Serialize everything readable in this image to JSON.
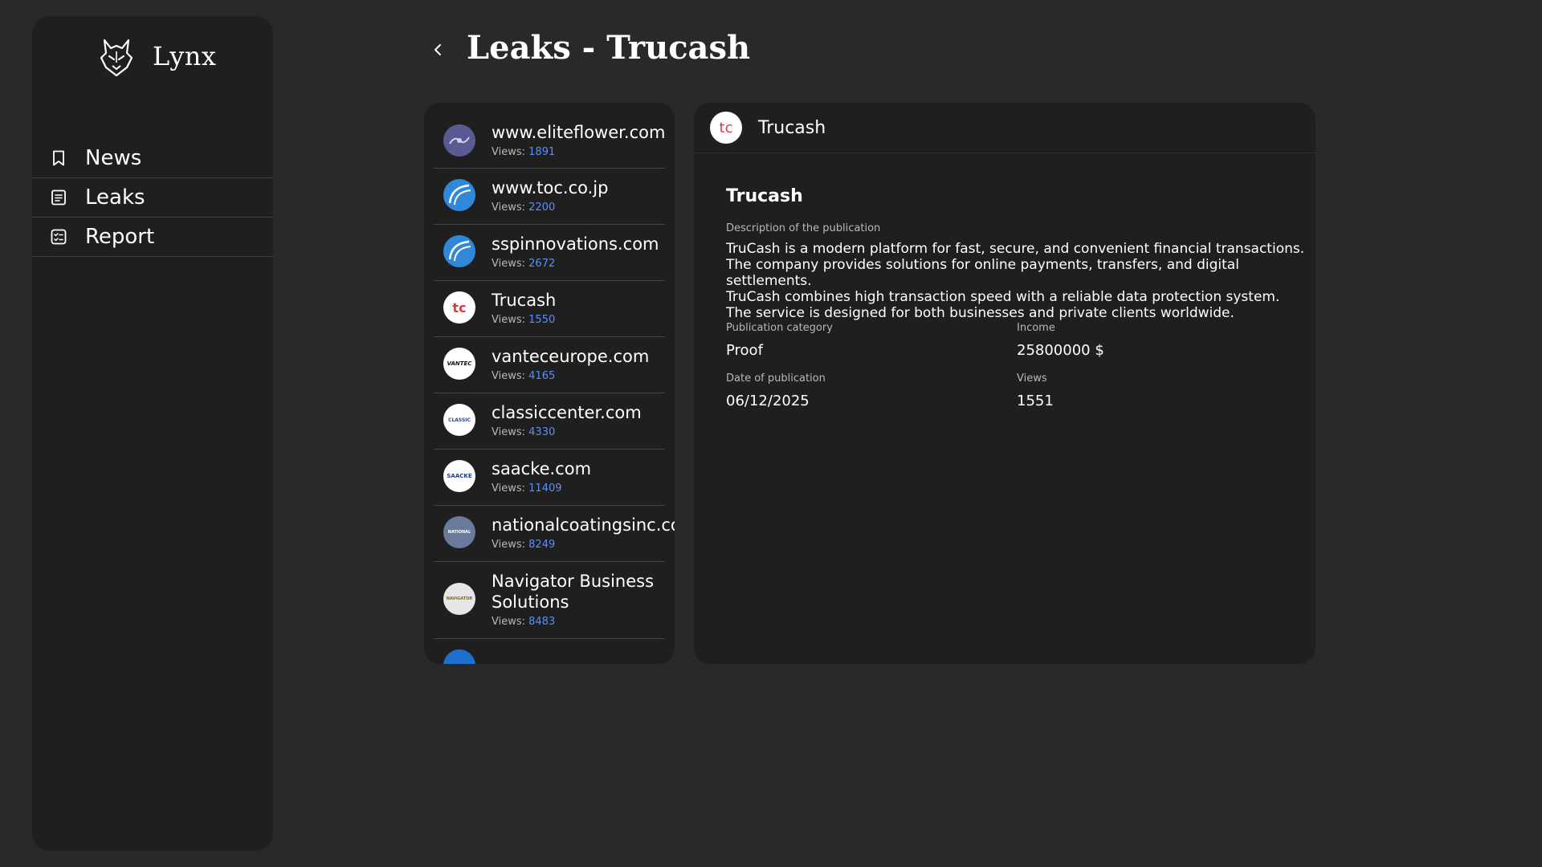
{
  "app": {
    "name": "Lynx"
  },
  "nav": [
    {
      "label": "News",
      "icon": "bookmark-icon"
    },
    {
      "label": "Leaks",
      "icon": "list-icon"
    },
    {
      "label": "Report",
      "icon": "checklist-icon"
    }
  ],
  "page": {
    "title": "Leaks - Trucash"
  },
  "views_label": "Views:",
  "leaks": [
    {
      "name": "www.eliteflower.com",
      "views": "1891",
      "avatar_color": "#5a5a92"
    },
    {
      "name": "www.toc.co.jp",
      "views": "2200",
      "avatar_color": "#2f88d8"
    },
    {
      "name": "sspinnovations.com",
      "views": "2672",
      "avatar_color": "#2f88d8"
    },
    {
      "name": "Trucash",
      "views": "1550",
      "avatar_color": "#ffffff",
      "avatar_text": "tc"
    },
    {
      "name": "vanteceurope.com",
      "views": "4165",
      "avatar_color": "#ffffff",
      "avatar_text": "VANTEC"
    },
    {
      "name": "classiccenter.com",
      "views": "4330",
      "avatar_color": "#ffffff",
      "avatar_text": "CLASSIC"
    },
    {
      "name": "saacke.com",
      "views": "11409",
      "avatar_color": "#ffffff",
      "avatar_text": "SAACKE"
    },
    {
      "name": "nationalcoatingsinc.com",
      "views": "8249",
      "avatar_color": "#6a7a9a",
      "avatar_text": "NATIONAL"
    },
    {
      "name": "Navigator Business Solutions",
      "views": "8483",
      "avatar_color": "#e6e6e6",
      "avatar_text": "NAVIGATOR"
    }
  ],
  "detail": {
    "header_name": "Trucash",
    "title": "Trucash",
    "description_label": "Description of the publication",
    "description": [
      "TruCash is a modern platform for fast, secure, and convenient financial transactions.",
      "The company provides solutions for online payments, transfers, and digital settlements.",
      "TruCash combines high transaction speed with a reliable data protection system.",
      "The service is designed for both businesses and private clients worldwide."
    ],
    "category_label": "Publication category",
    "category": "Proof",
    "income_label": "Income",
    "income": "25800000 $",
    "date_label": "Date of publication",
    "date": "06/12/2025",
    "views_label": "Views",
    "views": "1551"
  },
  "colors": {
    "background": "#292929",
    "panel": "#1f1f1f",
    "accent": "#5b8ff5",
    "brand_red": "#e03a3e"
  }
}
